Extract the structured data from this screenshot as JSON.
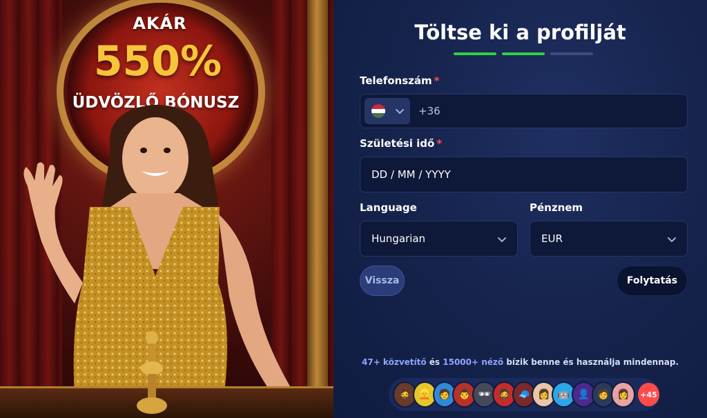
{
  "promo": {
    "line1": "AKÁR",
    "line2": "550%",
    "line3": "ÜDVÖZLŐ BÓNUSZ",
    "accent_color": "#f7c53a"
  },
  "form": {
    "title": "Töltse ki a profilját",
    "steps": [
      {
        "state": "done"
      },
      {
        "state": "done"
      },
      {
        "state": "pending"
      }
    ],
    "phone": {
      "label": "Telefonszám",
      "required_mark": "*",
      "country_flag": "hungary-flag-icon",
      "prefix": "+36"
    },
    "birthdate": {
      "label": "Születési idő",
      "required_mark": "*",
      "placeholder": "DD / MM / YYYY"
    },
    "language": {
      "label": "Language",
      "value": "Hungarian"
    },
    "currency": {
      "label": "Pénznem",
      "value": "EUR"
    },
    "back_button": "Vissza",
    "next_button": "Folytatás"
  },
  "social": {
    "streamers": "47+ közvetítő",
    "and": " és ",
    "viewers": "15000+ néző",
    "rest": " bízik benne és használja mindennap.",
    "more_count": "+45"
  },
  "colors": {
    "progress_done": "#2fd23f",
    "progress_pending": "#3d4d80",
    "required": "#ff4f4f",
    "badge": "#ff4b4b"
  }
}
